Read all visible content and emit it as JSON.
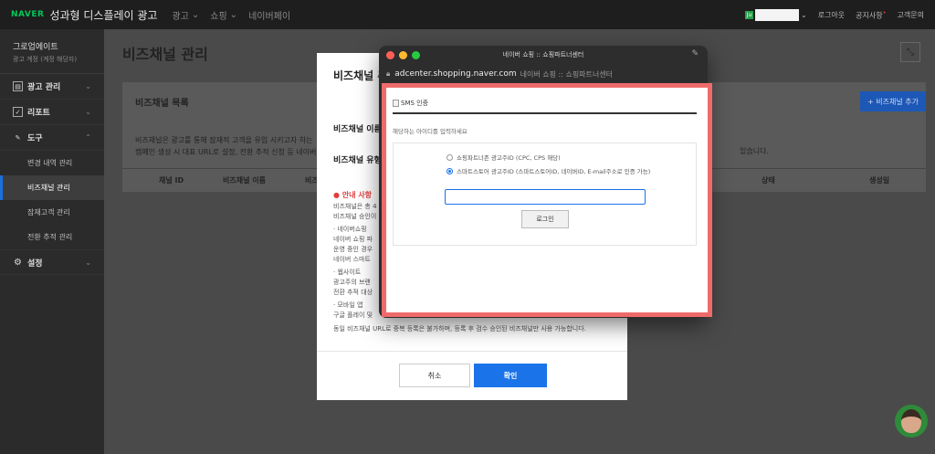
{
  "topbar": {
    "logo": "NAVER",
    "title": "성과형 디스플레이 광고",
    "nav": [
      {
        "label": "광고",
        "arrow": "⌄"
      },
      {
        "label": "쇼핑",
        "arrow": "⌄"
      },
      {
        "label": "네이버페이",
        "arrow": ""
      }
    ],
    "avatar_letter": "Ju",
    "user_arrow": "⌄",
    "logout": "로그아웃",
    "notice": "공지사항",
    "notice_badge": "•",
    "help": "고객문의"
  },
  "sidebar": {
    "account_name": "그로업에이트",
    "account_sub": "광고 계정 (계정 해당자)",
    "sections": [
      {
        "label": "광고 관리",
        "icon": "▤",
        "chev": "⌄"
      },
      {
        "label": "리포트",
        "icon": "✓",
        "chev": "⌄"
      },
      {
        "label": "도구",
        "icon": "✎",
        "chev": "⌃"
      }
    ],
    "sub_items": [
      "변경 내역 관리",
      "비즈채널 관리",
      "잠재고객 관리",
      "전환 추적 관리"
    ],
    "settings": {
      "label": "설정",
      "icon": "⚙",
      "chev": "⌄"
    }
  },
  "page": {
    "title": "비즈채널 관리",
    "expand_icon": "⤡",
    "card_title": "비즈채널 목록",
    "add_button": "+ 비즈채널 추가",
    "desc_line1": "비즈채널은 광고를 통해 잠재적 고객을 유입 시키고자 하는",
    "desc_line2": "캠페인 생성 시 대표 URL로 설정, 전환 추적 신청 등 네이버",
    "desc_right": "있습니다.",
    "columns": [
      "채널 ID",
      "비즈채널 이름",
      "비즈",
      "상태",
      "생성일"
    ]
  },
  "modal": {
    "title": "비즈채널 추",
    "field_name": "비즈채널 이름",
    "field_type": "비즈채널 유형",
    "notice_head": "● 안내 사항",
    "notice_lines": [
      "비즈채널은 총 4",
      "비즈채널 승인이",
      "· 네이버쇼핑",
      "   네이버 쇼핑 파",
      "   운영 중인 경우",
      "   네이버 스마트",
      "· 웹사이트",
      "   광고주의 브랜",
      "   전환 추적 대상",
      "· 모바일 앱",
      "   구글 플레이 및",
      "동일 비즈채널 URL로 중복 등록은 불가하며, 등록 후 검수 승인된 비즈채널만 사용 가능합니다."
    ],
    "cancel": "취소",
    "confirm": "확인"
  },
  "popup": {
    "window_title": "네이버 쇼핑 :: 쇼핑파트너센터",
    "pin_icon": "📌",
    "url_host": "adcenter.shopping.naver.com",
    "url_title": "네이버 쇼핑 :: 쇼핑파트너센터",
    "header": "SMS 인증",
    "instruction": "해당하는 아이디를 입력하세요",
    "radio_options": [
      {
        "label": "쇼핑파트너존 광고주ID (CPC, CPS 해당)",
        "checked": false
      },
      {
        "label": "스마트스토어 광고주ID (스마트스토어ID, 네이버ID, E-mail주소로 인증 가능)",
        "checked": true
      }
    ],
    "input_value": "",
    "login_button": "로그인"
  },
  "colors": {
    "accent_blue": "#1a73e8",
    "highlight_red": "#ef6a6a",
    "naver_green": "#03c75a"
  }
}
